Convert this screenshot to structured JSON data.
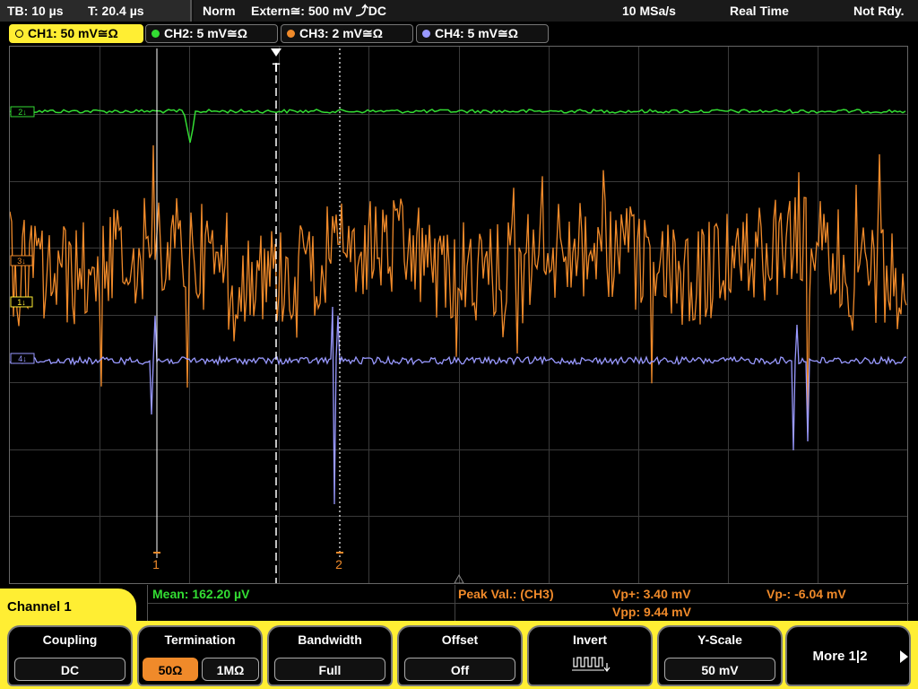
{
  "status": {
    "timebase": "TB: 10 µs",
    "trigger_pos": "T: 20.4 µs",
    "mode": "Norm",
    "trigger_source": "Extern≅: 500 mV ⤴DC",
    "sample_rate": "10 MSa/s",
    "acq_mode": "Real Time",
    "ready": "Not Rdy."
  },
  "channels": [
    {
      "label": "CH1: 50 mV≅Ω",
      "color": "#ffee33",
      "active": true
    },
    {
      "label": "CH2: 5 mV≅Ω",
      "color": "#33dd33",
      "active": false
    },
    {
      "label": "CH3: 2 mV≅Ω",
      "color": "#f08a2a",
      "active": false
    },
    {
      "label": "CH4: 5 mV≅Ω",
      "color": "#9999ff",
      "active": false
    }
  ],
  "display": {
    "trigger_marker": "T",
    "cursor1_label": "1",
    "cursor2_label": "2",
    "ch2_marker": "2↓",
    "ch3_marker": "3↓",
    "ch1_marker": "1↓",
    "ch4_marker": "4↓"
  },
  "measurements": {
    "mean": "Mean: 162.20 µV",
    "peak_title": "Peak Val.:  (CH3)",
    "vp_plus": "Vp+: 3.40 mV",
    "vp_minus": "Vp-: -6.04 mV",
    "vpp": "Vpp: 9.44 mV"
  },
  "menu": {
    "title": "Channel 1",
    "coupling": {
      "title": "Coupling",
      "value": "DC"
    },
    "termination": {
      "title": "Termination",
      "opt1": "50Ω",
      "opt2": "1MΩ",
      "selected": "50Ω"
    },
    "bandwidth": {
      "title": "Bandwidth",
      "value": "Full"
    },
    "offset": {
      "title": "Offset",
      "value": "Off"
    },
    "invert": {
      "title": "Invert"
    },
    "yscale": {
      "title": "Y-Scale",
      "value": "50 mV"
    },
    "more": {
      "label": "More 1|2"
    }
  },
  "colors": {
    "ch1": "#ffee33",
    "ch2": "#33dd33",
    "ch3": "#f08a2a",
    "ch4": "#9999ff",
    "grid": "#3a3a3a"
  }
}
